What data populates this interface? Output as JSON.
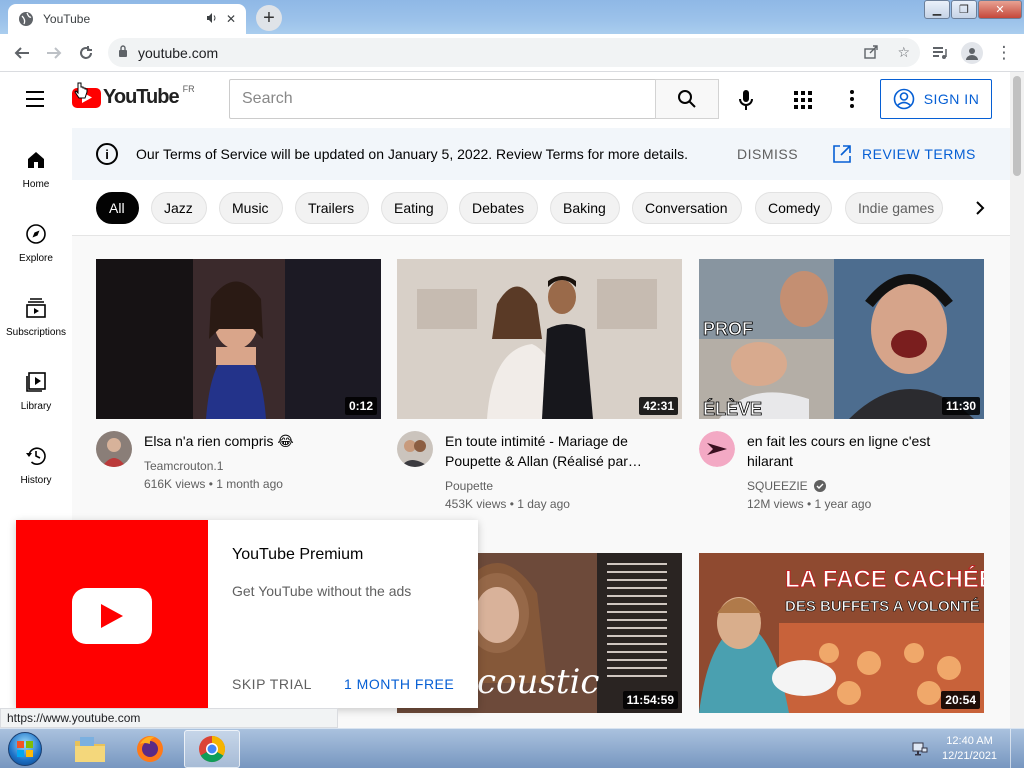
{
  "browser": {
    "tab_title": "YouTube",
    "url": "youtube.com",
    "status_url": "https://www.youtube.com"
  },
  "masthead": {
    "logo_text": "YouTube",
    "country_code": "FR",
    "search_placeholder": "Search",
    "sign_in": "SIGN IN"
  },
  "guide": [
    {
      "label": "Home",
      "icon": "home-icon"
    },
    {
      "label": "Explore",
      "icon": "compass-icon"
    },
    {
      "label": "Subscriptions",
      "icon": "subscriptions-icon"
    },
    {
      "label": "Library",
      "icon": "library-icon"
    },
    {
      "label": "History",
      "icon": "history-icon"
    }
  ],
  "notice": {
    "text": "Our Terms of Service will be updated on January 5, 2022. Review Terms for more details.",
    "dismiss": "DISMISS",
    "review": "REVIEW TERMS"
  },
  "chips": [
    "All",
    "Jazz",
    "Music",
    "Trailers",
    "Eating",
    "Debates",
    "Baking",
    "Conversation",
    "Comedy",
    "Indie games"
  ],
  "videos": [
    {
      "title": "Elsa n'a rien compris 😂",
      "channel": "Teamcrouton.1",
      "stats": "616K views • 1 month ago",
      "duration": "0:12"
    },
    {
      "title": "En toute intimité - Mariage de Poupette & Allan (Réalisé par…",
      "channel": "Poupette",
      "stats": "453K views • 1 day ago",
      "duration": "42:31"
    },
    {
      "title": "en fait les cours en ligne c'est hilarant",
      "channel": "SQUEEZIE",
      "stats": "12M views • 1 year ago",
      "duration": "11:30",
      "thumb_text_1": "PROF",
      "thumb_text_2": "ÉLÈVE"
    },
    {
      "duration": "11:54:59",
      "thumb_text": "coustic"
    },
    {
      "duration": "20:54",
      "thumb_text_1": "LA FACE CACHÉE",
      "thumb_text_2": "DES BUFFETS A VOLONTÉ"
    }
  ],
  "premium": {
    "title": "YouTube Premium",
    "subtitle": "Get YouTube without the ads",
    "skip": "SKIP TRIAL",
    "free": "1 MONTH FREE"
  },
  "taskbar": {
    "time": "12:40 AM",
    "date": "12/21/2021"
  },
  "colors": {
    "yt_red": "#ff0000",
    "link_blue": "#065fd4",
    "chip_active": "#030303"
  }
}
